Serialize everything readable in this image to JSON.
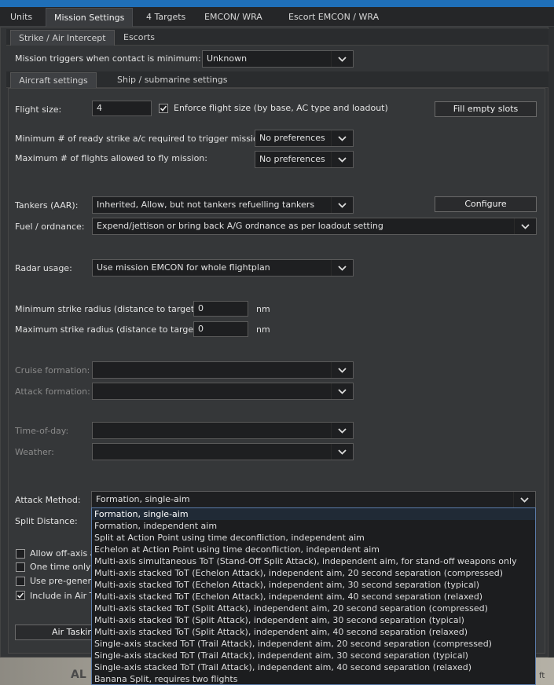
{
  "top_tabs": [
    "Units",
    "Mission Settings",
    "4 Targets",
    "EMCON/ WRA",
    "Escort EMCON / WRA"
  ],
  "mission_tabs": [
    "Strike / Air Intercept",
    "Escorts"
  ],
  "trigger": {
    "label": "Mission triggers when contact is minimum:",
    "value": "Unknown"
  },
  "settings_tabs": [
    "Aircraft settings",
    "Ship / submarine settings"
  ],
  "flight_size": {
    "label": "Flight size:",
    "value": "4",
    "enforce_label": "Enforce flight size (by base, AC type and loadout)",
    "fill_button": "Fill empty slots"
  },
  "min_ready": {
    "label": "Minimum # of ready strike a/c required to trigger mission:",
    "value": "No preferences"
  },
  "max_flights": {
    "label": "Maximum # of flights allowed to fly mission:",
    "value": "No preferences"
  },
  "tankers": {
    "label": "Tankers (AAR):",
    "value": "Inherited, Allow, but not tankers refuelling tankers",
    "button": "Configure"
  },
  "fuel": {
    "label": "Fuel / ordnance:",
    "value": "Expend/jettison or bring back A/G ordnance as per loadout setting"
  },
  "radar": {
    "label": "Radar usage:",
    "value": "Use mission EMCON for whole flightplan"
  },
  "min_radius": {
    "label": "Minimum strike radius (distance to target):",
    "value": "0",
    "unit": "nm"
  },
  "max_radius": {
    "label": "Maximum strike radius (distance to target):",
    "value": "0",
    "unit": "nm"
  },
  "cruise_formation": {
    "label": "Cruise formation:"
  },
  "attack_formation": {
    "label": "Attack formation:"
  },
  "time_of_day": {
    "label": "Time-of-day:"
  },
  "weather": {
    "label": "Weather:"
  },
  "attack_method": {
    "label": "Attack Method:",
    "value": "Formation, single-aim",
    "options": [
      "Formation, single-aim",
      "Formation, independent aim",
      "Split at Action Point using time deconfliction, independent aim",
      "Echelon at Action Point using time deconfliction, independent aim",
      "Multi-axis simultaneous ToT (Stand-Off Split Attack), independent aim, for stand-off weapons only",
      "Multi-axis stacked ToT (Echelon Attack), independent aim, 20 second separation (compressed)",
      "Multi-axis stacked ToT (Echelon Attack), independent aim, 30 second separation (typical)",
      "Multi-axis stacked ToT (Echelon Attack), independent aim, 40 second separation (relaxed)",
      "Multi-axis stacked ToT (Split Attack), independent aim, 20 second separation (compressed)",
      "Multi-axis stacked ToT (Split Attack), independent aim, 30 second separation (typical)",
      "Multi-axis stacked ToT (Split Attack), independent aim, 40 second separation (relaxed)",
      "Single-axis stacked ToT (Trail Attack), independent aim, 20 second separation (compressed)",
      "Single-axis stacked ToT (Trail Attack), independent aim, 30 second separation (typical)",
      "Single-axis stacked ToT (Trail Attack), independent aim, 40 second separation (relaxed)",
      "Banana Split, requires two flights"
    ]
  },
  "split_distance": {
    "label": "Split Distance:"
  },
  "checkboxes": [
    {
      "label": "Allow off-axis a",
      "checked": false
    },
    {
      "label": "One time only (",
      "checked": false
    },
    {
      "label": "Use pre-genera",
      "checked": false
    },
    {
      "label": "Include in Air Ta",
      "checked": true
    }
  ],
  "air_tasking_button": "Air Tasking",
  "map": {
    "label": "AL",
    "corner": "ft"
  }
}
